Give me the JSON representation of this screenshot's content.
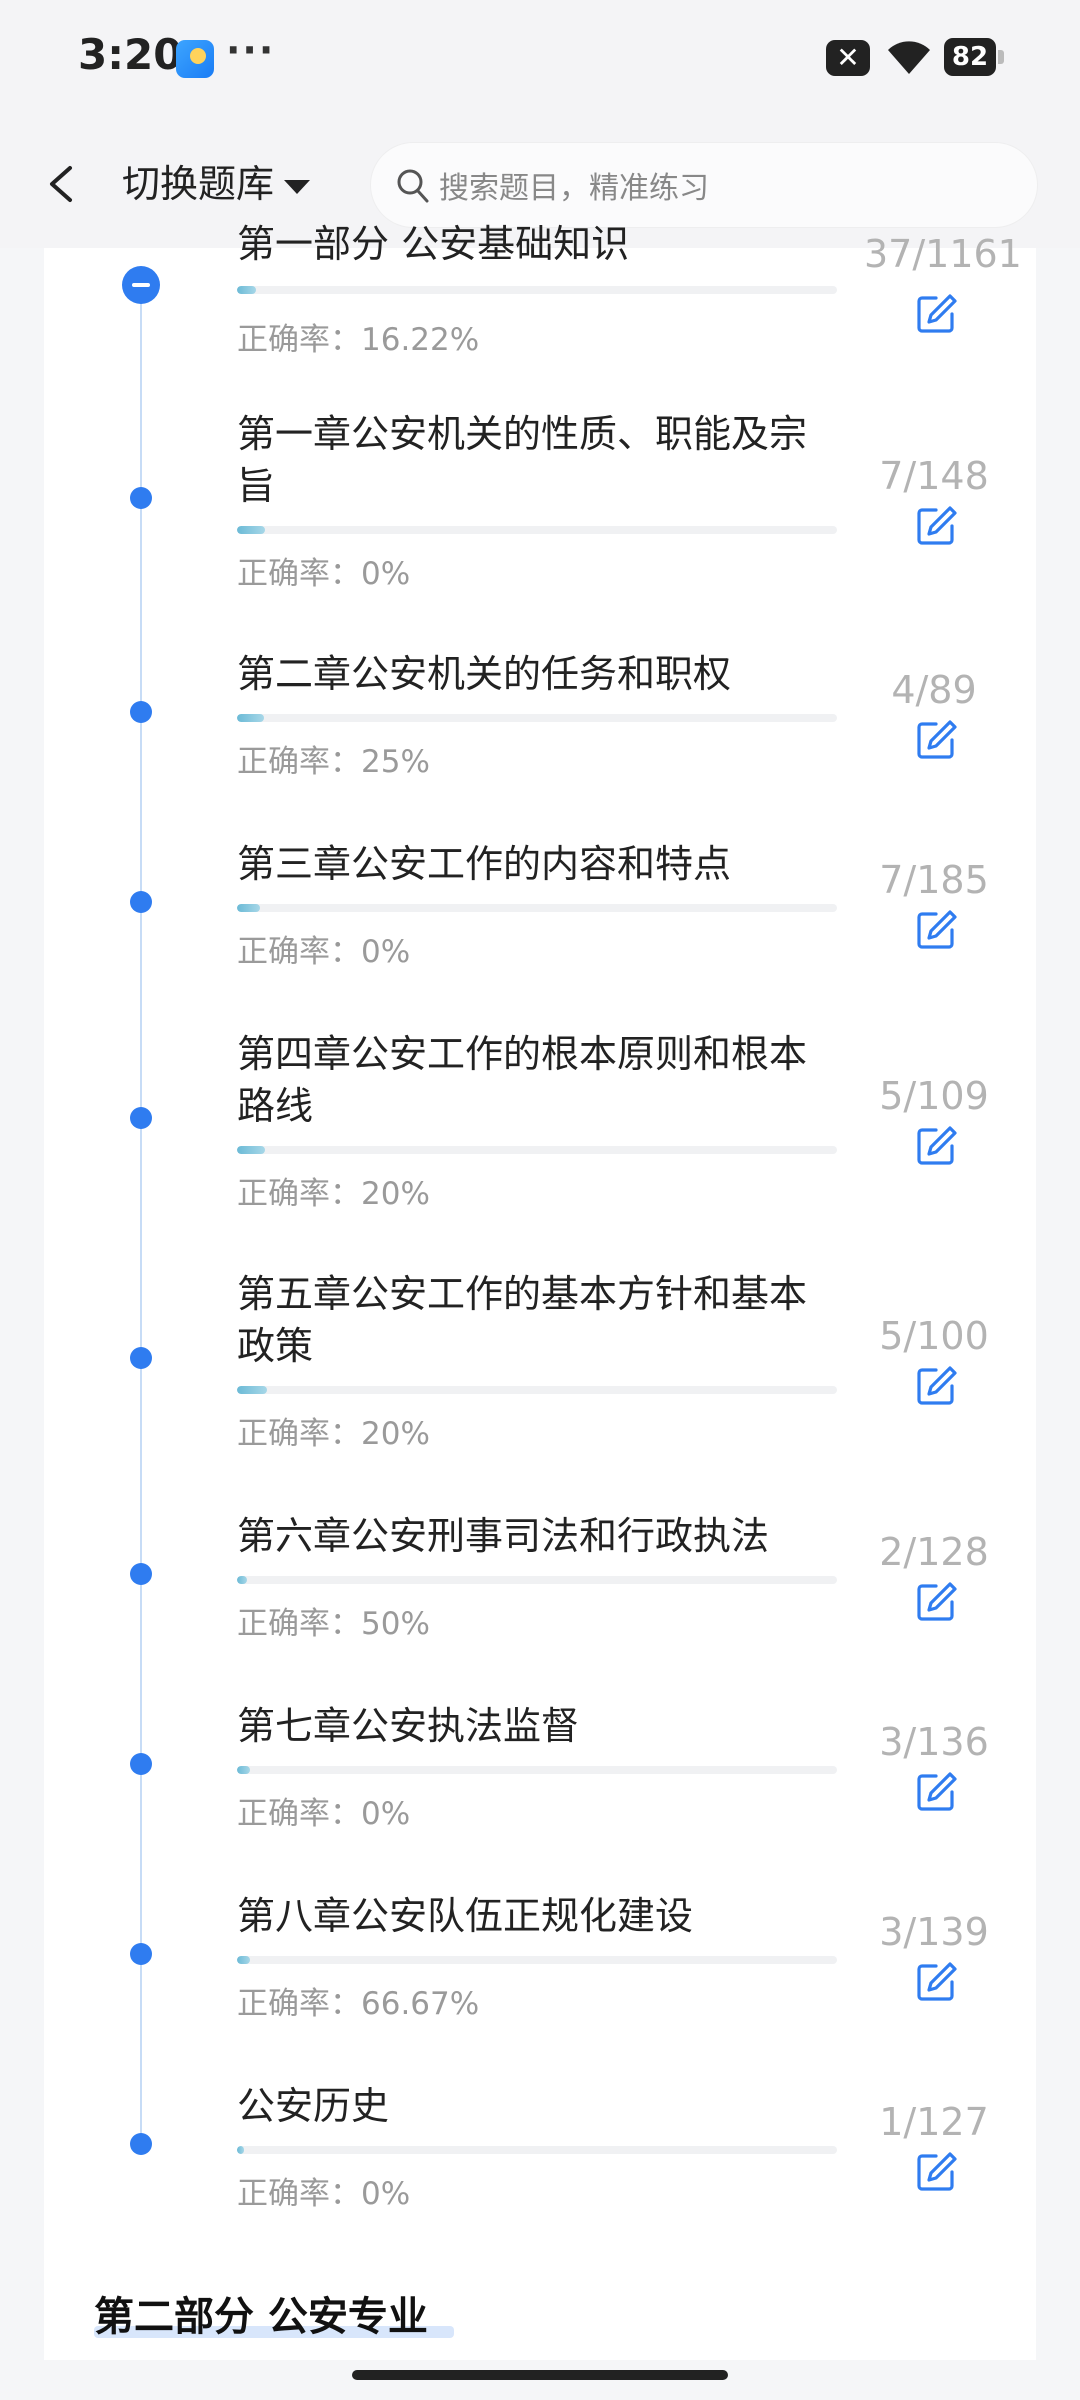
{
  "status_bar": {
    "time": "3:20",
    "more": "···",
    "battery": "82",
    "icons": [
      "weather-app-icon",
      "close-notification-icon",
      "wifi-icon",
      "battery-icon"
    ]
  },
  "header": {
    "switch_bank_label": "切换题库",
    "search_placeholder": "搜索题目，精准练习"
  },
  "part1": {
    "title_partial": "第一部分 公安基础知识",
    "count": "37/1161",
    "accuracy": "正确率：16.22%",
    "progress": 0.032
  },
  "chapters": [
    {
      "title": "第一章公安机关的性质、职能及宗旨",
      "count": "7/148",
      "accuracy": "正确率：0%",
      "progress": 0.047
    },
    {
      "title": "第二章公安机关的任务和职权",
      "count": "4/89",
      "accuracy": "正确率：25%",
      "progress": 0.045
    },
    {
      "title": "第三章公安工作的内容和特点",
      "count": "7/185",
      "accuracy": "正确率：0%",
      "progress": 0.038
    },
    {
      "title": "第四章公安工作的根本原则和根本路线",
      "count": "5/109",
      "accuracy": "正确率：20%",
      "progress": 0.046
    },
    {
      "title": "第五章公安工作的基本方针和基本政策",
      "count": "5/100",
      "accuracy": "正确率：20%",
      "progress": 0.05
    },
    {
      "title": "第六章公安刑事司法和行政执法",
      "count": "2/128",
      "accuracy": "正确率：50%",
      "progress": 0.016
    },
    {
      "title": "第七章公安执法监督",
      "count": "3/136",
      "accuracy": "正确率：0%",
      "progress": 0.022
    },
    {
      "title": "第八章公安队伍正规化建设",
      "count": "3/139",
      "accuracy": "正确率：66.67%",
      "progress": 0.022
    },
    {
      "title": "公安历史",
      "count": "1/127",
      "accuracy": "正确率：0%",
      "progress": 0.008
    }
  ],
  "part2": {
    "title": "第二部分 公安专业"
  },
  "colors": {
    "accent": "#2f7cf0",
    "progress_fill": "#6bbad6",
    "muted_text": "#9a9a9a"
  }
}
